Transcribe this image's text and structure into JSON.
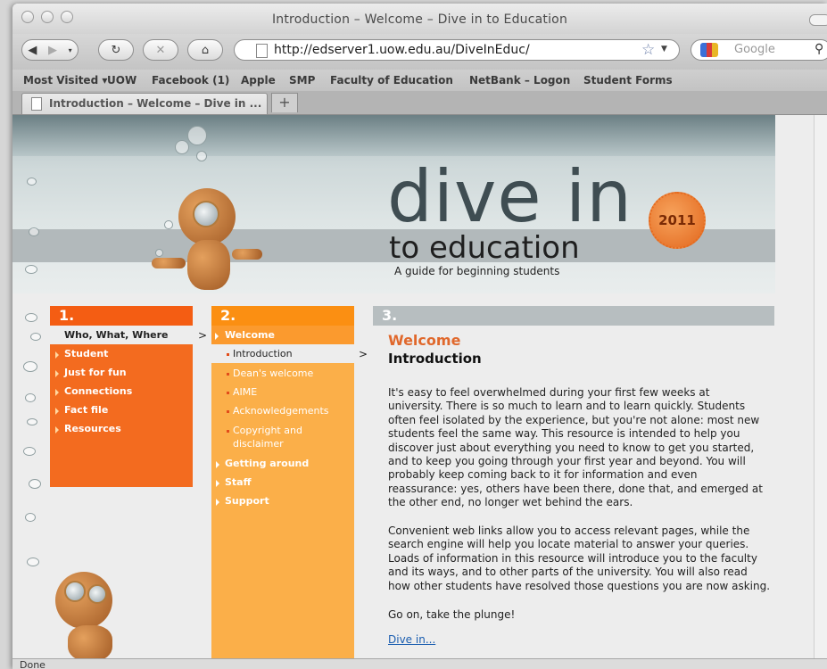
{
  "window": {
    "title": "Introduction – Welcome – Dive in to Education"
  },
  "toolbar": {
    "url": "http://edserver1.uow.edu.au/DiveInEduc/",
    "search_placeholder": "Google"
  },
  "bookmarks": [
    "Most Visited ▾",
    "UOW",
    "Facebook (1)",
    "Apple",
    "SMP",
    "Faculty of Education",
    "NetBank – Logon",
    "Student Forms"
  ],
  "tab": {
    "label": "Introduction – Welcome – Dive in ...",
    "new_tab": "+"
  },
  "banner": {
    "title": "dive in",
    "subtitle_line": "to education",
    "tagline": "A guide for beginning students",
    "badge": "2011"
  },
  "columns": {
    "col1_num": "1.",
    "col2_num": "2.",
    "col3_num": "3.",
    "col1_items": [
      "Who, What, Where",
      "Student",
      "Just for fun",
      "Connections",
      "Fact file",
      "Resources"
    ],
    "col2_items": [
      "Welcome",
      "Introduction",
      "Dean's welcome",
      "AIME",
      "Acknowledgements",
      "Copyright and",
      "disclaimer",
      "Getting around",
      "Staff",
      "Support"
    ],
    "arrow": ">"
  },
  "main": {
    "heading": "Welcome",
    "subheading": "Introduction",
    "para1_lines": [
      "It's easy to feel overwhelmed during your first few weeks at",
      "university. There is so much to learn and to learn quickly. Students",
      "often feel isolated by the experience, but you're not alone: most new",
      "students feel the same way. This resource is intended to help you",
      "discover just about everything you need to know to get you started,",
      "and to keep you going through your first year and beyond. You will",
      "probably keep coming back to it for information and even",
      "reassurance: yes, others have been there, done that, and emerged at",
      "the other end, no longer wet behind the ears."
    ],
    "para2_lines": [
      "Convenient web links allow you to access relevant pages, while the",
      "search engine will help you locate material to answer your queries.",
      "Loads of information in this resource will introduce you to the faculty",
      "and its ways, and to other parts of the university. You will also read",
      "how other students have resolved those questions you are now asking."
    ],
    "para3": "Go on, take the plunge!",
    "link": "Dive in..."
  },
  "status": {
    "text": "Done"
  }
}
